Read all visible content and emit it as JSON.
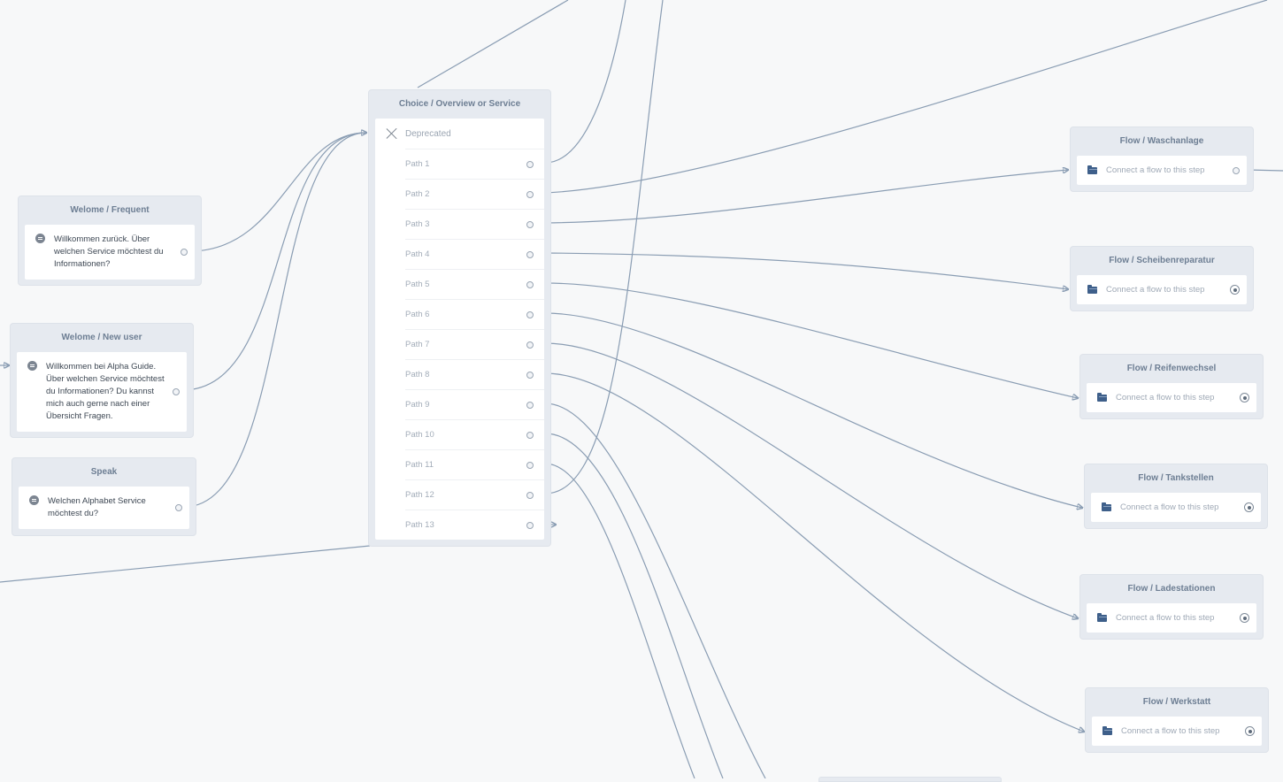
{
  "canvas": {
    "edge_color": "#8a9db3",
    "background": "#f7f8f9",
    "node_color": "#e6eaf0"
  },
  "nodes": {
    "welcome_frequent": {
      "title": "Welome / Frequent",
      "icon": "speech-bubble-icon",
      "text": "Willkommen zurück. Über welchen Service möchtest du Informationen?"
    },
    "welcome_new_user": {
      "title": "Welome / New user",
      "icon": "speech-bubble-icon",
      "text": "Willkommen bei Alpha Guide. Über welchen Service möchtest du Informationen? Du kannst mich auch gerne nach einer Übersicht Fragen."
    },
    "speak": {
      "title": "Speak",
      "icon": "speech-bubble-icon",
      "text": "Welchen Alphabet Service möchtest du?"
    },
    "choice": {
      "title": "Choice / Overview or Service",
      "deprecated_label": "Deprecated",
      "deprecated_icon": "x-icon",
      "paths": [
        "Path 1",
        "Path 2",
        "Path 3",
        "Path 4",
        "Path 5",
        "Path 6",
        "Path 7",
        "Path 8",
        "Path 9",
        "Path 10",
        "Path 11",
        "Path 12",
        "Path 13"
      ]
    },
    "flows": [
      {
        "title": "Flow / Waschanlage",
        "text": "Connect a flow to this step",
        "icon": "folder-icon",
        "port": "port-circle"
      },
      {
        "title": "Flow / Scheibenreparatur",
        "text": "Connect a flow to this step",
        "icon": "folder-icon",
        "port": "target-icon"
      },
      {
        "title": "Flow / Reifenwechsel",
        "text": "Connect a flow to this step",
        "icon": "folder-icon",
        "port": "target-icon"
      },
      {
        "title": "Flow / Tankstellen",
        "text": "Connect a flow to this step",
        "icon": "folder-icon",
        "port": "target-icon"
      },
      {
        "title": "Flow / Ladestationen",
        "text": "Connect a flow to this step",
        "icon": "folder-icon",
        "port": "target-icon"
      },
      {
        "title": "Flow / Werkstatt",
        "text": "Connect a flow to this step",
        "icon": "folder-icon",
        "port": "target-icon"
      }
    ]
  }
}
